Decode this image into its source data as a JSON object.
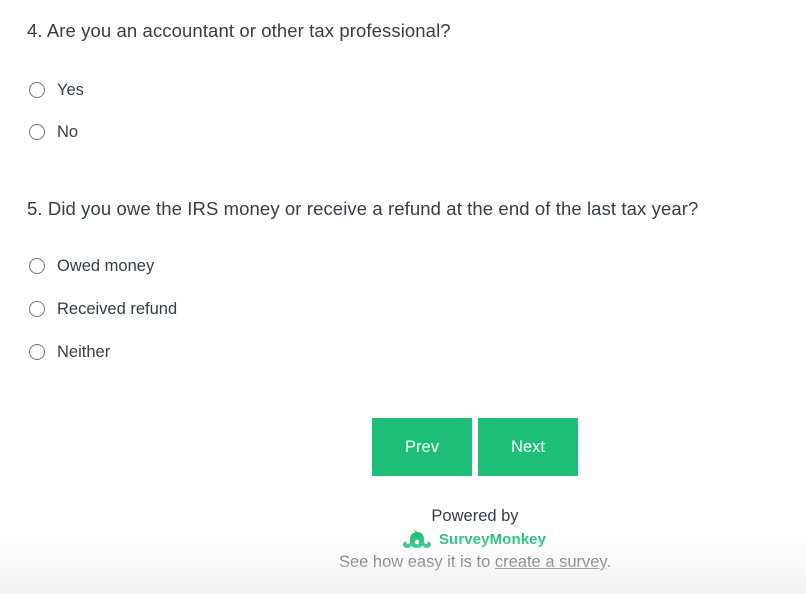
{
  "questions": [
    {
      "title": "4. Are you an accountant or other tax professional?",
      "options": [
        "Yes",
        "No"
      ]
    },
    {
      "title": "5. Did you owe the IRS money or receive a refund at the end of the last tax year?",
      "options": [
        "Owed money",
        "Received refund",
        "Neither"
      ]
    }
  ],
  "navigation": {
    "prev_label": "Prev",
    "next_label": "Next"
  },
  "footer": {
    "powered_by": "Powered by",
    "brand": "SurveyMonkey",
    "brand_mark": "·",
    "tagline_prefix": "See how easy it is to ",
    "tagline_link": "create a survey",
    "tagline_suffix": ".",
    "logo_icon": "surveymonkey-logo-icon"
  },
  "colors": {
    "accent": "#1ebe78",
    "text": "#333e48",
    "radio_border": "#6b787f"
  }
}
